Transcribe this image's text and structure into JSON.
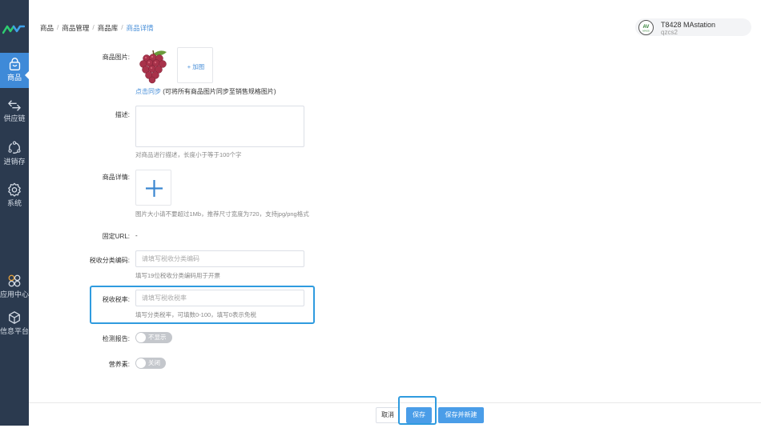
{
  "sidebar": {
    "items": [
      {
        "label": "商品",
        "icon": "basket-icon",
        "active": true
      },
      {
        "label": "供应链",
        "icon": "exchange-icon"
      },
      {
        "label": "进销存",
        "icon": "cycle-icon"
      },
      {
        "label": "系统",
        "icon": "gear-icon"
      },
      {
        "label": "应用中心",
        "icon": "apps-icon"
      },
      {
        "label": "信息平台",
        "icon": "cube-icon"
      }
    ]
  },
  "breadcrumb": [
    "商品",
    "商品管理",
    "商品库",
    "商品详情"
  ],
  "user": {
    "name": "T8428 MAstation",
    "sub": "qzcs2",
    "avatar_text": "AV",
    "avatar_caption": "MASS"
  },
  "form": {
    "product_image": {
      "label": "商品图片:",
      "add_label": "+ 加图",
      "sync_link": "点击同步",
      "sync_hint": " (可将所有商品图片同步至销售规格图片)"
    },
    "description": {
      "label": "描述:",
      "value": "",
      "hint": "对商品进行描述，长度小于等于100个字"
    },
    "detail": {
      "label": "商品详情:",
      "hint": "图片大小请不要超过1Mb，推荐尺寸宽度为720，支持jpg/png格式"
    },
    "fixed_url": {
      "label": "固定URL:",
      "value": "-"
    },
    "tax_code": {
      "label": "税收分类编码:",
      "placeholder": "请填写税收分类编码",
      "hint": "填写19位税收分类编码用于开票"
    },
    "tax_rate": {
      "label": "税收税率:",
      "placeholder": "请填写税收税率",
      "hint": "填写分类税率，可填数0-100，填写0表示免税"
    },
    "test_report": {
      "label": "检测报告:",
      "toggle_text": "不显示"
    },
    "nutrition": {
      "label": "营养素:",
      "toggle_text": "关闭"
    }
  },
  "footer": {
    "cancel": "取消",
    "save": "保存",
    "save_new": "保存并新建"
  },
  "colors": {
    "sidebar_bg": "#2b3a4f",
    "active_bg": "#3f8ad8",
    "primary": "#4a9de8",
    "highlight": "#2f9bdf"
  }
}
